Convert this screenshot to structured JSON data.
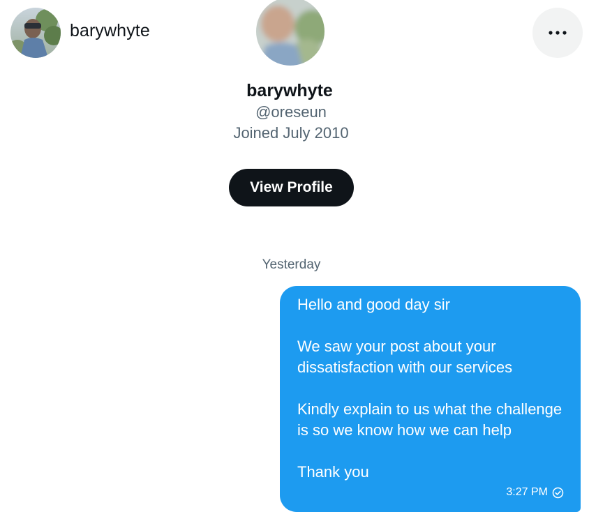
{
  "header": {
    "display_name": "barywhyte",
    "avatar_icon": "user-avatar-photo",
    "more_icon": "more-horizontal-icon"
  },
  "profile": {
    "display_name": "barywhyte",
    "handle": "@oreseun",
    "joined": "Joined July 2010",
    "view_profile_label": "View Profile"
  },
  "conversation": {
    "date_divider": "Yesterday",
    "messages": [
      {
        "text": "Hello and good day sir\n\nWe saw your post about your dissatisfaction with our services\n\nKindly explain to us what the challenge is so we know how we can help\n\nThank you",
        "time": "3:27 PM",
        "status_icon": "sent-check-icon"
      }
    ]
  },
  "colors": {
    "bubble": "#1d9bf0",
    "button_dark": "#0f1419",
    "secondary_text": "#536471",
    "more_button_bg": "#f2f3f3"
  }
}
